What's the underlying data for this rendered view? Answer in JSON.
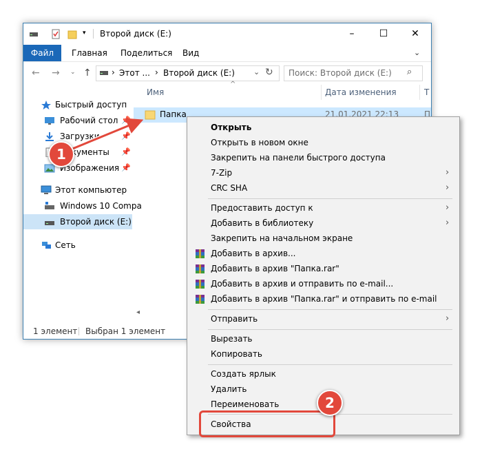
{
  "window": {
    "title": "Второй диск (E:)",
    "controls": [
      "–",
      "☐",
      "✕"
    ]
  },
  "ribbon": {
    "tabs": [
      "Файл",
      "Главная",
      "Поделиться",
      "Вид"
    ]
  },
  "address": {
    "crumbs": [
      "Этот ...",
      "Второй диск (E:)"
    ],
    "search_placeholder": "Поиск: Второй диск (E:)"
  },
  "nav": {
    "quick_access": "Быстрый доступ",
    "desktop": "Рабочий стол",
    "downloads": "Загрузки",
    "documents": "Документы",
    "images": "Изображения",
    "this_pc": "Этот компьютер",
    "windows": "Windows 10 Compa",
    "drive_e": "Второй диск (E:)",
    "network": "Сеть"
  },
  "content": {
    "col_name": "Имя",
    "col_date": "Дата изменения",
    "col_type": "Т",
    "rows": [
      {
        "name": "Папка",
        "date": "21.01.2021 22:13",
        "type": "П"
      }
    ]
  },
  "status": {
    "count": "1 элемент",
    "selected": "Выбран 1 элемент"
  },
  "menu": {
    "items": [
      "Открыть",
      "Открыть в новом окне",
      "Закрепить на панели быстрого доступа",
      "7-Zip",
      "CRC SHA",
      "Предоставить доступ к",
      "Добавить в библиотеку",
      "Закрепить на начальном экране",
      "Добавить в архив...",
      "Добавить в архив \"Папка.rar\"",
      "Добавить в архив и отправить по e-mail...",
      "Добавить в архив \"Папка.rar\" и отправить по e-mail",
      "Отправить",
      "Вырезать",
      "Копировать",
      "Создать ярлык",
      "Удалить",
      "Переименовать",
      "Свойства"
    ]
  },
  "annotations": {
    "step1": "1",
    "step2": "2"
  },
  "colors": {
    "accent": "#1a68b8",
    "selection": "#cce8ff",
    "annotation": "#e2483b"
  },
  "icons": [
    "drive-icon",
    "folder-icon",
    "star-icon",
    "desktop-icon",
    "download-icon",
    "documents-icon",
    "images-icon",
    "computer-icon",
    "network-icon",
    "winrar-icon",
    "pin-icon"
  ]
}
